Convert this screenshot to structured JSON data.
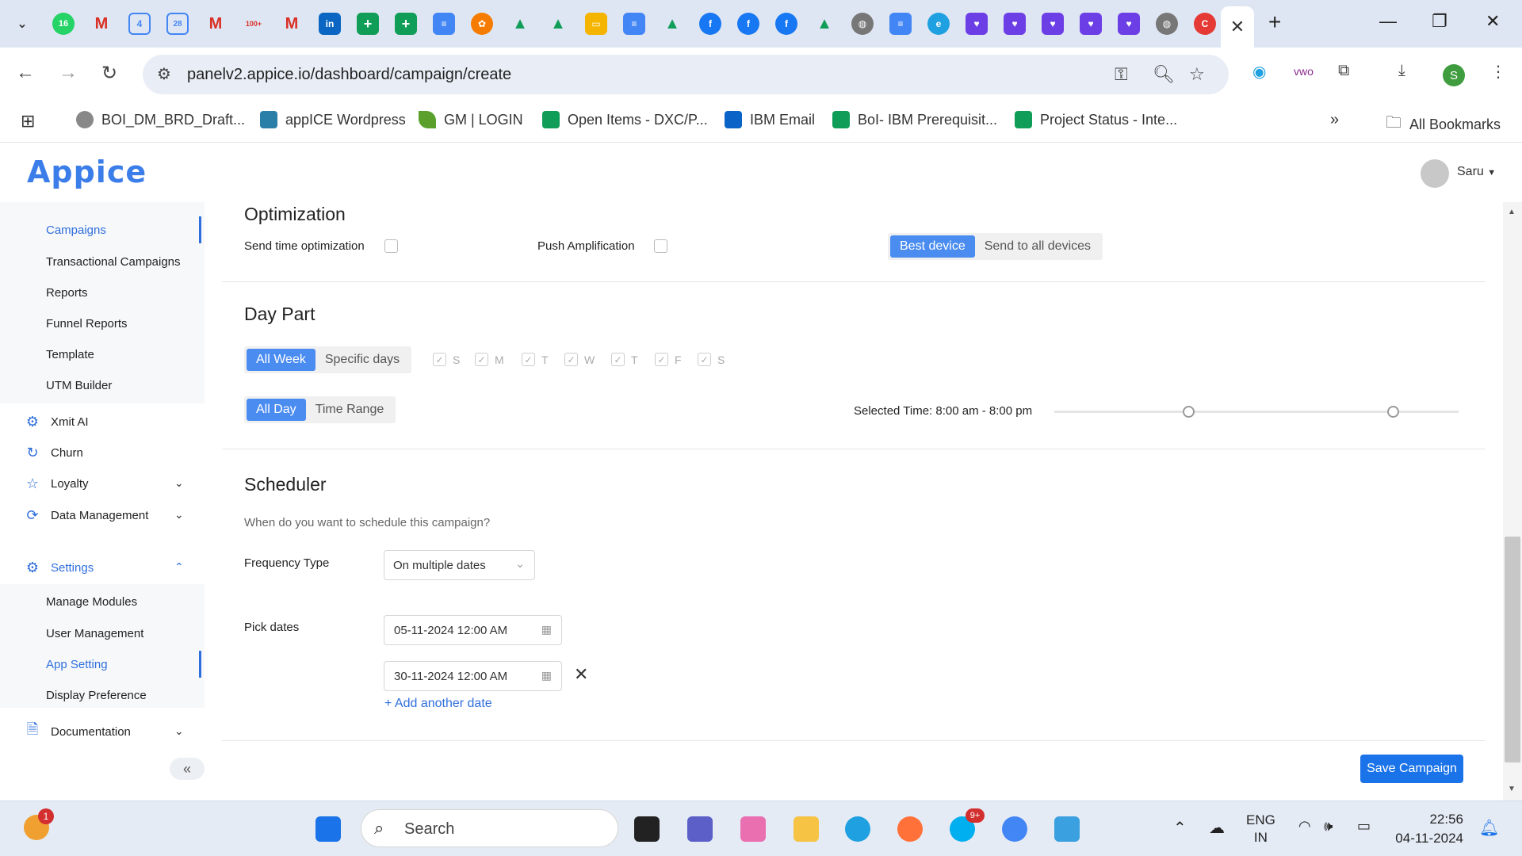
{
  "browser": {
    "url": "panelv2.appice.io/dashboard/campaign/create",
    "tab_badges": {
      "whatsapp_count": "16",
      "calendar_day_1": "4",
      "calendar_day_2": "28",
      "gmail_count": "100+"
    },
    "bookmarks": [
      {
        "label": "BOI_DM_BRD_Draft...",
        "icon": "globe-icon"
      },
      {
        "label": "appICE Wordpress",
        "icon": "wordpress-icon"
      },
      {
        "label": "GM | LOGIN",
        "icon": "leaf-icon"
      },
      {
        "label": "Open Items - DXC/P...",
        "icon": "sheets-icon"
      },
      {
        "label": "IBM Email",
        "icon": "outlook-icon"
      },
      {
        "label": "BoI- IBM Prerequisit...",
        "icon": "sheets-icon"
      },
      {
        "label": "Project Status - Inte...",
        "icon": "sheets-icon"
      }
    ],
    "all_bookmarks": "All Bookmarks",
    "profile_initial": "S"
  },
  "app": {
    "logo": "Appice",
    "user_name": "Saru"
  },
  "sidebar": {
    "sub_top": [
      "Campaigns",
      "Transactional Campaigns",
      "Reports",
      "Funnel Reports",
      "Template",
      "UTM Builder"
    ],
    "main": [
      {
        "label": "Xmit AI",
        "icon": "ai-gear-icon"
      },
      {
        "label": "Churn",
        "icon": "refresh-icon"
      },
      {
        "label": "Loyalty",
        "icon": "star-icon"
      },
      {
        "label": "Data Management",
        "icon": "sync-icon"
      }
    ],
    "settings": "Settings",
    "sub_settings": [
      "Manage Modules",
      "User Management",
      "App Setting",
      "Display Preference"
    ],
    "documentation": "Documentation",
    "collapse": "«"
  },
  "optimization": {
    "title": "Optimization",
    "send_time": "Send time optimization",
    "push_amp": "Push Amplification",
    "device_options": [
      "Best device",
      "Send to all devices"
    ]
  },
  "daypart": {
    "title": "Day Part",
    "week_options": [
      "All Week",
      "Specific days"
    ],
    "days": [
      "S",
      "M",
      "T",
      "W",
      "T",
      "F",
      "S"
    ],
    "day_options": [
      "All Day",
      "Time Range"
    ],
    "selected_time": "Selected Time: 8:00 am - 8:00 pm"
  },
  "scheduler": {
    "title": "Scheduler",
    "question": "When do you want to schedule this campaign?",
    "freq_label": "Frequency Type",
    "freq_value": "On multiple dates",
    "pick_label": "Pick dates",
    "dates": [
      "05-11-2024 12:00 AM",
      "30-11-2024 12:00 AM"
    ],
    "add_date": "+ Add another date"
  },
  "save_button": "Save Campaign",
  "taskbar": {
    "search": "Search",
    "lang_1": "ENG",
    "lang_2": "IN",
    "time": "22:56",
    "date": "04-11-2024",
    "notif_badge": "1",
    "skype_badge": "9+"
  },
  "colors": {
    "accent": "#2f6fdc",
    "toggle_on": "#4a8cf0",
    "save": "#1a73e8"
  }
}
